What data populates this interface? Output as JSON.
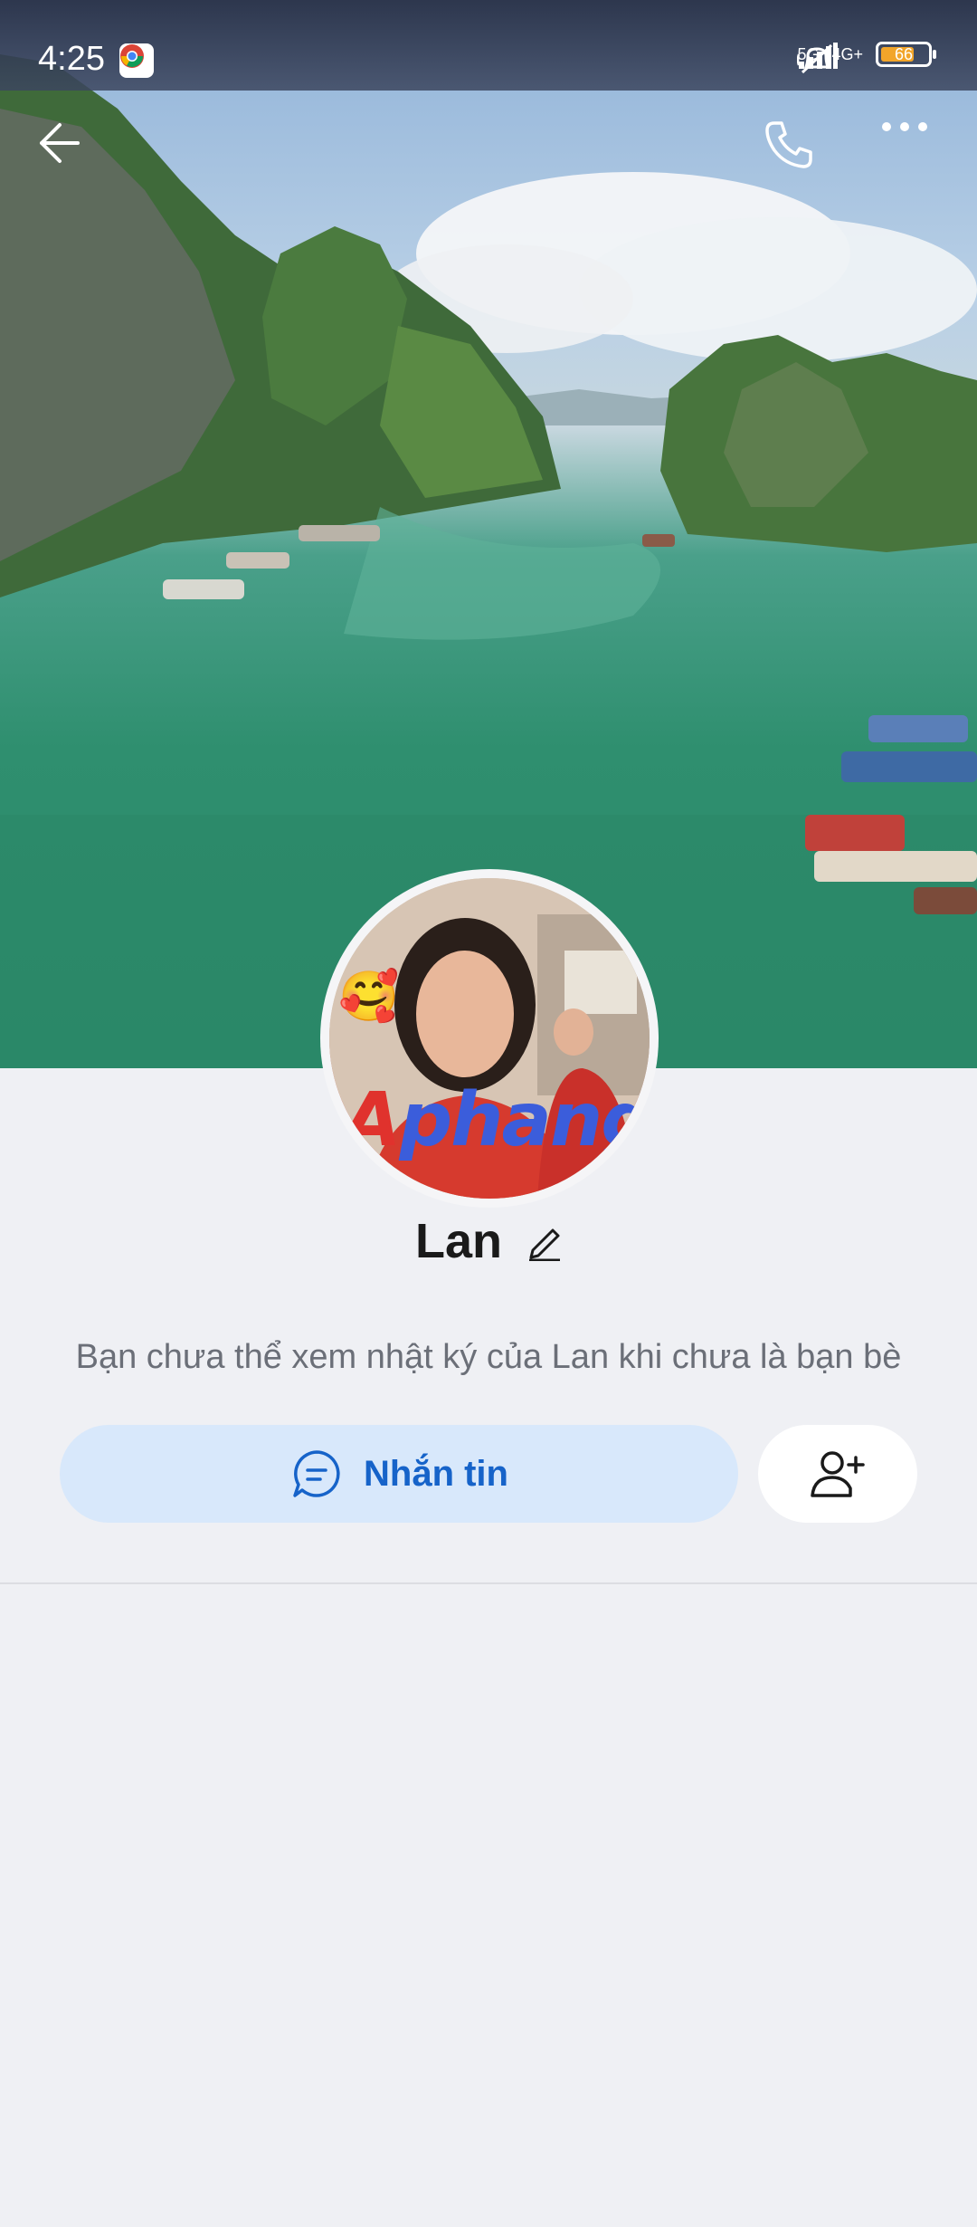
{
  "status_bar": {
    "time": "4:25",
    "network_1": "5G",
    "network_2": "4G+",
    "battery": "66",
    "icons": [
      "chrome-icon",
      "mute-icon",
      "signal-icon",
      "battery-icon"
    ]
  },
  "top_bar": {
    "icons": [
      "back-arrow-icon",
      "phone-icon",
      "more-icon"
    ]
  },
  "profile": {
    "name": "Lan",
    "avatar_watermark_a": "A",
    "avatar_watermark_b": "phang",
    "avatar_emoji": "🥰",
    "info_text": "Bạn chưa thể xem nhật ký của Lan khi chưa là bạn bè"
  },
  "actions": {
    "message_label": "Nhắn tin",
    "message_icon": "chat-bubble-icon",
    "add_friend_icon": "add-user-icon"
  },
  "colors": {
    "accent": "#1663c9",
    "message_button_bg": "#d8e8fb",
    "page_bg": "#eff0f4"
  }
}
